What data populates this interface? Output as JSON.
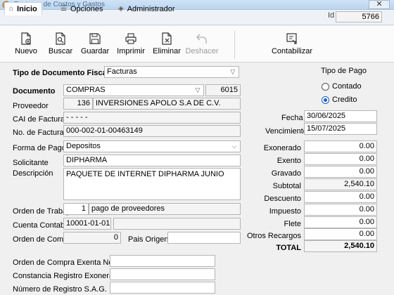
{
  "window": {
    "title": "Facturas de Costos y Gastos",
    "close": "✕"
  },
  "tabs": [
    {
      "label": "Inicio",
      "icon": "home-icon"
    },
    {
      "label": "Opciones",
      "icon": "list-icon"
    },
    {
      "label": "Administrador",
      "icon": "shield-icon"
    }
  ],
  "record": {
    "id_label": "Id",
    "id_value": "5766"
  },
  "toolbar": {
    "nuevo": "Nuevo",
    "buscar": "Buscar",
    "guardar": "Guardar",
    "imprimir": "Imprimir",
    "eliminar": "Eliminar",
    "deshacer": "Deshacer",
    "contabilizar": "Contabilizar"
  },
  "form": {
    "tipo_doc_label": "Tipo de Documento Fiscal",
    "tipo_doc_value": "Facturas",
    "documento_label": "Documento",
    "documento_value": "COMPRAS",
    "documento_num": "6015",
    "proveedor_label": "Proveedor",
    "proveedor_code": "136",
    "proveedor_name": "INVERSIONES APOLO S.A DE C.V.",
    "cai_label": "CAI de Factura",
    "cai_value": "-       -       -       -       -",
    "nofactura_label": "No. de Factura",
    "nofactura_value": "000-002-01-00463149",
    "formapago_label": "Forma de Pago",
    "formapago_value": "Depositos",
    "solicitante_label": "Solicitante",
    "solicitante_value": "DIPHARMA",
    "descripcion_label": "Descripción",
    "descripcion_value": "PAQUETE DE INTERNET DIPHARMA JUNIO",
    "orden_trabajo_label": "Orden de Trabajo",
    "orden_trabajo_num": "1",
    "orden_trabajo_desc": "pago de proveedores",
    "cuenta_label": "Cuenta Contable",
    "cuenta_value": "10001-01-01",
    "orden_compra_label": "Orden de Compra",
    "orden_compra_value": "0",
    "pais_label": "Pais Origen",
    "pais_value": "",
    "oc_exenta_label": "Orden de Compra Exenta No.",
    "constancia_label": "Constancia Registro Exonerados",
    "sag_label": "Número de Registro S.A.G."
  },
  "pago": {
    "title": "Tipo de Pago",
    "contado": "Contado",
    "credito": "Credito",
    "selected": "credito"
  },
  "dates": {
    "fecha_label": "Fecha",
    "fecha_value": "30/06/2025",
    "venc_label": "Vencimiento",
    "venc_value": "15/07/2025"
  },
  "totals": {
    "exonerado_label": "Exonerado",
    "exonerado": "0.00",
    "exento_label": "Exento",
    "exento": "0.00",
    "gravado_label": "Gravado",
    "gravado": "0.00",
    "subtotal_label": "Subtotal",
    "subtotal": "2,540.10",
    "descuento_label": "Descuento",
    "descuento": "0.00",
    "impuesto_label": "Impuesto",
    "impuesto": "0.00",
    "flete_label": "Flete",
    "flete": "0.00",
    "otros_label": "Otros Recargos",
    "otros": "0.00",
    "total_label": "TOTAL",
    "total": "2,540.10"
  }
}
